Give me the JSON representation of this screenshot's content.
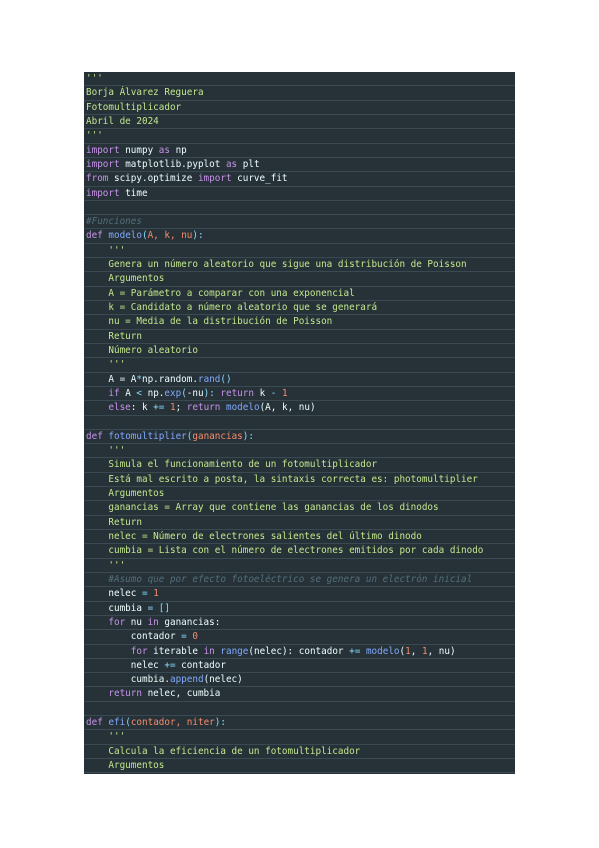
{
  "lines": [
    {
      "t": "'''",
      "c": "string"
    },
    {
      "t": "Borja Álvarez Reguera",
      "c": "string"
    },
    {
      "t": "Fotomultiplicador",
      "c": "string"
    },
    {
      "t": "Abril de 2024",
      "c": "string"
    },
    {
      "t": "'''",
      "c": "string"
    },
    {
      "s": [
        {
          "t": "import",
          "c": "#c792ea"
        },
        {
          "t": " numpy ",
          "c": "#eeffff"
        },
        {
          "t": "as",
          "c": "#c792ea"
        },
        {
          "t": " np",
          "c": "#eeffff"
        }
      ]
    },
    {
      "s": [
        {
          "t": "import",
          "c": "#c792ea"
        },
        {
          "t": " matplotlib.pyplot ",
          "c": "#eeffff"
        },
        {
          "t": "as",
          "c": "#c792ea"
        },
        {
          "t": " plt",
          "c": "#eeffff"
        }
      ]
    },
    {
      "s": [
        {
          "t": "from",
          "c": "#c792ea"
        },
        {
          "t": " scipy.optimize ",
          "c": "#eeffff"
        },
        {
          "t": "import",
          "c": "#c792ea"
        },
        {
          "t": " curve_fit",
          "c": "#eeffff"
        }
      ]
    },
    {
      "s": [
        {
          "t": "import",
          "c": "#c792ea"
        },
        {
          "t": " time",
          "c": "#eeffff"
        }
      ]
    },
    {
      "t": "",
      "c": ""
    },
    {
      "t": "#Funciones",
      "c": "comment"
    },
    {
      "s": [
        {
          "t": "def",
          "c": "#c792ea"
        },
        {
          "t": " ",
          "c": "#eeffff"
        },
        {
          "t": "modelo",
          "c": "#82aaff"
        },
        {
          "t": "(",
          "c": "#89ddff"
        },
        {
          "t": "A, k, nu",
          "c": "#f78c6c"
        },
        {
          "t": "):",
          "c": "#89ddff"
        }
      ]
    },
    {
      "t": "    '''",
      "c": "string"
    },
    {
      "t": "    Genera un número aleatorio que sigue una distribución de Poisson",
      "c": "string"
    },
    {
      "t": "    Argumentos",
      "c": "string"
    },
    {
      "t": "    A = Parámetro a comparar con una exponencial",
      "c": "string"
    },
    {
      "t": "    k = Candidato a número aleatorio que se generará",
      "c": "string"
    },
    {
      "t": "    nu = Media de la distribución de Poisson",
      "c": "string"
    },
    {
      "t": "    Return",
      "c": "string"
    },
    {
      "t": "    Número aleatorio",
      "c": "string"
    },
    {
      "t": "    '''",
      "c": "string"
    },
    {
      "s": [
        {
          "t": "    A = A",
          "c": "#eeffff"
        },
        {
          "t": "*",
          "c": "#89ddff"
        },
        {
          "t": "np.random.",
          "c": "#eeffff"
        },
        {
          "t": "rand",
          "c": "#82aaff"
        },
        {
          "t": "()",
          "c": "#89ddff"
        }
      ]
    },
    {
      "s": [
        {
          "t": "    if",
          "c": "#c792ea"
        },
        {
          "t": " A ",
          "c": "#eeffff"
        },
        {
          "t": "<",
          "c": "#89ddff"
        },
        {
          "t": " np.",
          "c": "#eeffff"
        },
        {
          "t": "exp",
          "c": "#82aaff"
        },
        {
          "t": "(",
          "c": "#89ddff"
        },
        {
          "t": "-nu",
          "c": "#eeffff"
        },
        {
          "t": "):",
          "c": "#89ddff"
        },
        {
          "t": " return",
          "c": "#c792ea"
        },
        {
          "t": " k ",
          "c": "#eeffff"
        },
        {
          "t": "-",
          "c": "#89ddff"
        },
        {
          "t": " 1",
          "c": "#f78c6c"
        }
      ]
    },
    {
      "s": [
        {
          "t": "    else",
          "c": "#c792ea"
        },
        {
          "t": ": k ",
          "c": "#eeffff"
        },
        {
          "t": "+=",
          "c": "#89ddff"
        },
        {
          "t": " 1",
          "c": "#f78c6c"
        },
        {
          "t": "; ",
          "c": "#eeffff"
        },
        {
          "t": "return",
          "c": "#c792ea"
        },
        {
          "t": " ",
          "c": "#eeffff"
        },
        {
          "t": "modelo",
          "c": "#82aaff"
        },
        {
          "t": "(A, k, nu)",
          "c": "#eeffff"
        }
      ]
    },
    {
      "t": "",
      "c": ""
    },
    {
      "s": [
        {
          "t": "def",
          "c": "#c792ea"
        },
        {
          "t": " ",
          "c": "#eeffff"
        },
        {
          "t": "fotomultiplier",
          "c": "#82aaff"
        },
        {
          "t": "(",
          "c": "#89ddff"
        },
        {
          "t": "ganancias",
          "c": "#f78c6c"
        },
        {
          "t": "):",
          "c": "#89ddff"
        }
      ]
    },
    {
      "t": "    '''",
      "c": "string"
    },
    {
      "t": "    Simula el funcionamiento de un fotomultiplicador",
      "c": "string"
    },
    {
      "t": "    Está mal escrito a posta, la sintaxis correcta es: photomultiplier",
      "c": "string"
    },
    {
      "t": "    Argumentos",
      "c": "string"
    },
    {
      "t": "    ganancias = Array que contiene las ganancias de los dinodos",
      "c": "string"
    },
    {
      "t": "    Return",
      "c": "string"
    },
    {
      "t": "    nelec = Número de electrones salientes del último dinodo",
      "c": "string"
    },
    {
      "t": "    cumbia = Lista con el número de electrones emitidos por cada dinodo",
      "c": "string"
    },
    {
      "t": "    '''",
      "c": "string"
    },
    {
      "t": "    #Asumo que por efecto fotoeléctrico se genera un electrón inicial",
      "c": "comment"
    },
    {
      "s": [
        {
          "t": "    nelec ",
          "c": "#eeffff"
        },
        {
          "t": "=",
          "c": "#89ddff"
        },
        {
          "t": " 1",
          "c": "#f78c6c"
        }
      ]
    },
    {
      "s": [
        {
          "t": "    cumbia ",
          "c": "#eeffff"
        },
        {
          "t": "=",
          "c": "#89ddff"
        },
        {
          "t": " []",
          "c": "#89ddff"
        }
      ]
    },
    {
      "s": [
        {
          "t": "    for",
          "c": "#c792ea"
        },
        {
          "t": " nu ",
          "c": "#eeffff"
        },
        {
          "t": "in",
          "c": "#c792ea"
        },
        {
          "t": " ganancias:",
          "c": "#eeffff"
        }
      ]
    },
    {
      "s": [
        {
          "t": "        contador ",
          "c": "#eeffff"
        },
        {
          "t": "=",
          "c": "#89ddff"
        },
        {
          "t": " 0",
          "c": "#f78c6c"
        }
      ]
    },
    {
      "s": [
        {
          "t": "        for",
          "c": "#c792ea"
        },
        {
          "t": " iterable ",
          "c": "#eeffff"
        },
        {
          "t": "in",
          "c": "#c792ea"
        },
        {
          "t": " ",
          "c": "#eeffff"
        },
        {
          "t": "range",
          "c": "#82aaff"
        },
        {
          "t": "(nelec): contador ",
          "c": "#eeffff"
        },
        {
          "t": "+=",
          "c": "#89ddff"
        },
        {
          "t": " ",
          "c": "#eeffff"
        },
        {
          "t": "modelo",
          "c": "#82aaff"
        },
        {
          "t": "(",
          "c": "#eeffff"
        },
        {
          "t": "1",
          "c": "#f78c6c"
        },
        {
          "t": ", ",
          "c": "#eeffff"
        },
        {
          "t": "1",
          "c": "#f78c6c"
        },
        {
          "t": ", nu)",
          "c": "#eeffff"
        }
      ]
    },
    {
      "s": [
        {
          "t": "        nelec ",
          "c": "#eeffff"
        },
        {
          "t": "+=",
          "c": "#89ddff"
        },
        {
          "t": " contador",
          "c": "#eeffff"
        }
      ]
    },
    {
      "s": [
        {
          "t": "        cumbia.",
          "c": "#eeffff"
        },
        {
          "t": "append",
          "c": "#82aaff"
        },
        {
          "t": "(nelec)",
          "c": "#eeffff"
        }
      ]
    },
    {
      "s": [
        {
          "t": "    return",
          "c": "#c792ea"
        },
        {
          "t": " nelec, cumbia",
          "c": "#eeffff"
        }
      ]
    },
    {
      "t": "",
      "c": ""
    },
    {
      "s": [
        {
          "t": "def",
          "c": "#c792ea"
        },
        {
          "t": " ",
          "c": "#eeffff"
        },
        {
          "t": "efi",
          "c": "#82aaff"
        },
        {
          "t": "(",
          "c": "#89ddff"
        },
        {
          "t": "contador, niter",
          "c": "#f78c6c"
        },
        {
          "t": "):",
          "c": "#89ddff"
        }
      ]
    },
    {
      "t": "    '''",
      "c": "string"
    },
    {
      "t": "    Calcula la eficiencia de un fotomultiplicador",
      "c": "string"
    },
    {
      "t": "    Argumentos",
      "c": "string"
    }
  ]
}
